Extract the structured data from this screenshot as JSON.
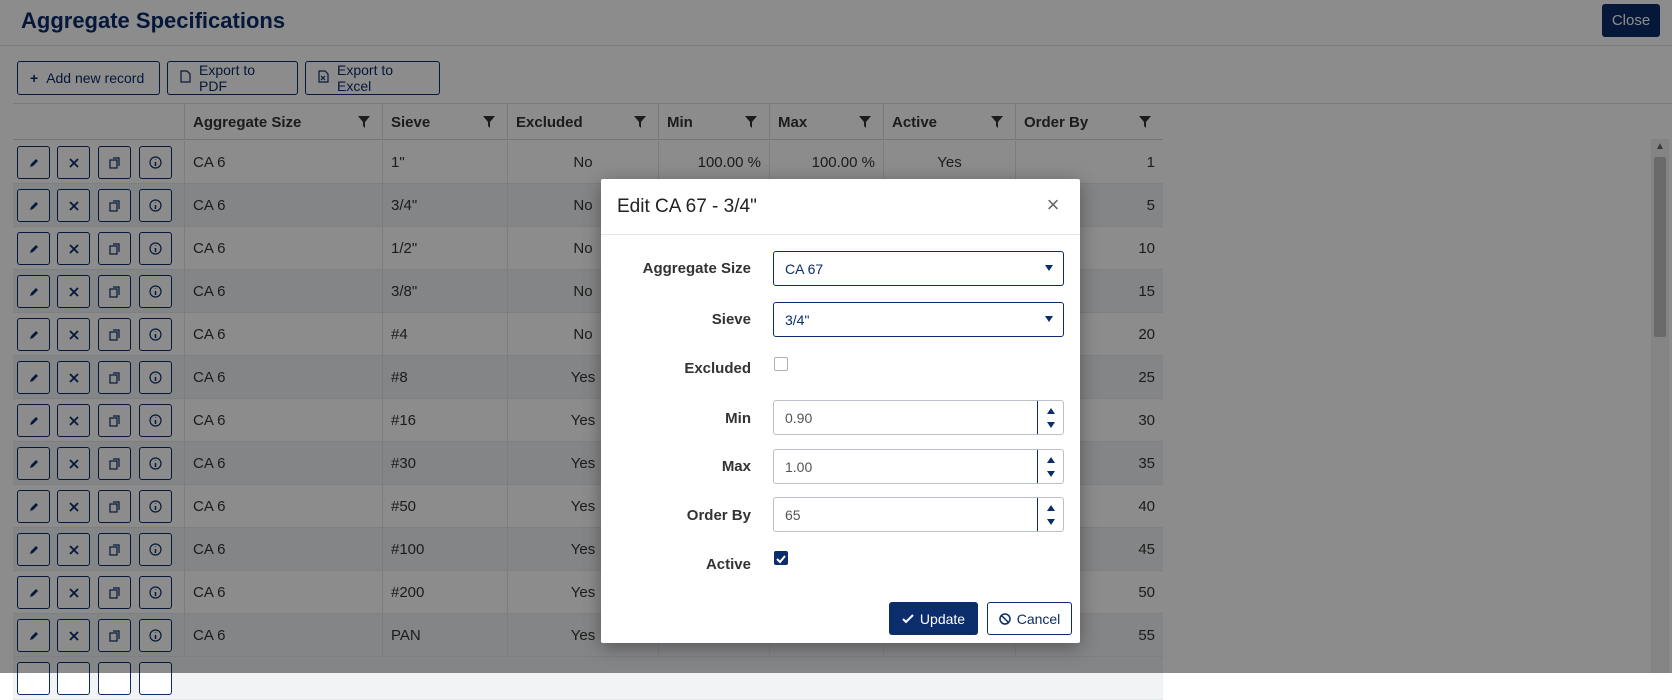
{
  "header": {
    "title": "Aggregate Specifications",
    "close_label": "Close"
  },
  "toolbar": {
    "add_label": "Add new record",
    "pdf_label": "Export to PDF",
    "excel_label": "Export to Excel"
  },
  "grid": {
    "columns": [
      "Aggregate Size",
      "Sieve",
      "Excluded",
      "Min",
      "Max",
      "Active",
      "Order By"
    ],
    "rows": [
      {
        "size": "CA 6",
        "sieve": "1\"",
        "excluded": "No",
        "min": "100.00 %",
        "max": "100.00 %",
        "active": "Yes",
        "order": "1"
      },
      {
        "size": "CA 6",
        "sieve": "3/4\"",
        "excluded": "No",
        "min": "",
        "max": "",
        "active": "",
        "order": "5"
      },
      {
        "size": "CA 6",
        "sieve": "1/2\"",
        "excluded": "No",
        "min": "",
        "max": "",
        "active": "",
        "order": "10"
      },
      {
        "size": "CA 6",
        "sieve": "3/8\"",
        "excluded": "No",
        "min": "",
        "max": "",
        "active": "",
        "order": "15"
      },
      {
        "size": "CA 6",
        "sieve": "#4",
        "excluded": "No",
        "min": "",
        "max": "",
        "active": "",
        "order": "20"
      },
      {
        "size": "CA 6",
        "sieve": "#8",
        "excluded": "Yes",
        "min": "",
        "max": "",
        "active": "",
        "order": "25"
      },
      {
        "size": "CA 6",
        "sieve": "#16",
        "excluded": "Yes",
        "min": "",
        "max": "",
        "active": "",
        "order": "30"
      },
      {
        "size": "CA 6",
        "sieve": "#30",
        "excluded": "Yes",
        "min": "",
        "max": "",
        "active": "",
        "order": "35"
      },
      {
        "size": "CA 6",
        "sieve": "#50",
        "excluded": "Yes",
        "min": "",
        "max": "",
        "active": "",
        "order": "40"
      },
      {
        "size": "CA 6",
        "sieve": "#100",
        "excluded": "Yes",
        "min": "",
        "max": "",
        "active": "",
        "order": "45"
      },
      {
        "size": "CA 6",
        "sieve": "#200",
        "excluded": "Yes",
        "min": "",
        "max": "",
        "active": "",
        "order": "50"
      },
      {
        "size": "CA 6",
        "sieve": "PAN",
        "excluded": "Yes",
        "min": "",
        "max": "",
        "active": "",
        "order": "55"
      }
    ]
  },
  "icons": {
    "edit": "pencil-icon",
    "delete": "x-icon",
    "copy": "copy-icon",
    "info": "info-icon",
    "filter": "filter-icon"
  },
  "modal": {
    "title": "Edit CA 67 - 3/4\"",
    "close_symbol": "×",
    "fields": {
      "aggregate_size_label": "Aggregate Size",
      "aggregate_size_value": "CA 67",
      "sieve_label": "Sieve",
      "sieve_value": "3/4\"",
      "excluded_label": "Excluded",
      "min_label": "Min",
      "min_value": "0.90",
      "max_label": "Max",
      "max_value": "1.00",
      "order_label": "Order By",
      "order_value": "65",
      "active_label": "Active"
    },
    "update_label": "Update",
    "cancel_label": "Cancel"
  },
  "colors": {
    "brand": "#0c2d6b",
    "overlay": "rgba(0,0,0,0.45)"
  }
}
